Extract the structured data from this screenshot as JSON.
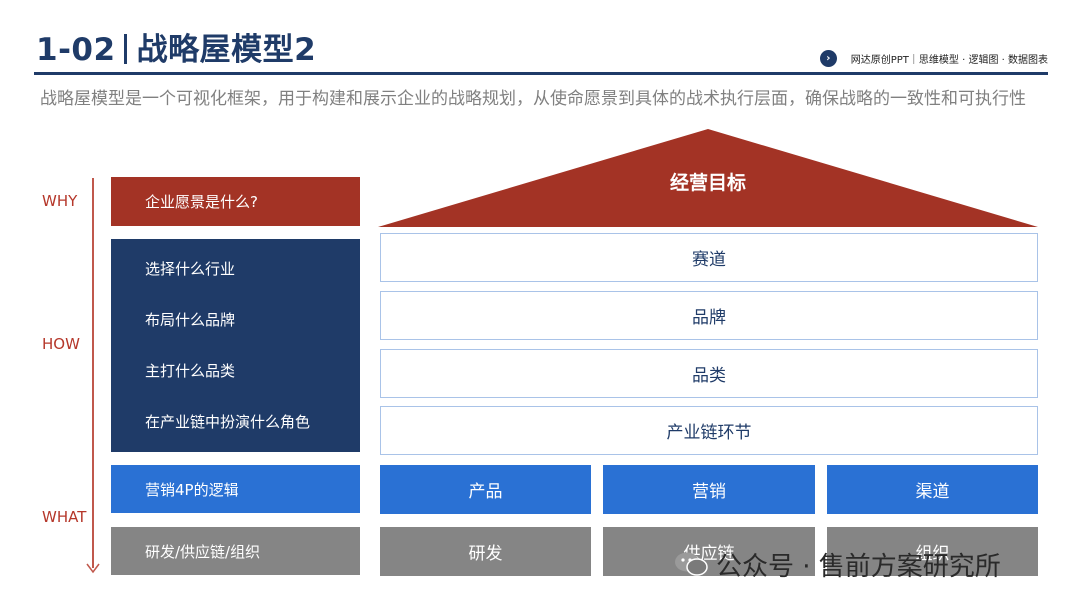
{
  "header": {
    "number": "1-02",
    "title": "战略屋模型2",
    "tagline": "网达原创PPT｜思维模型 · 逻辑图 · 数据图表"
  },
  "description": "战略屋模型是一个可视化框架，用于构建和展示企业的战略规划，从使命愿景到具体的战术执行层面，确保战略的一致性和可执行性",
  "axis": {
    "why": "WHY",
    "how": "HOW",
    "what": "WHAT"
  },
  "left": {
    "why_question": "企业愿景是什么?",
    "how_items": [
      "选择什么行业",
      "布局什么品牌",
      "主打什么品类",
      "在产业链中扮演什么角色"
    ],
    "marketing": "营销4P的逻辑",
    "supply": "研发/供应链/组织"
  },
  "house": {
    "roof": "经营目标",
    "floors": [
      "赛道",
      "品牌",
      "品类",
      "产业链环节"
    ],
    "blue_row": [
      "产品",
      "营销",
      "渠道"
    ],
    "gray_row": [
      "研发",
      "供应链",
      "组织"
    ]
  },
  "watermark": "公众号 · 售前方案研究所",
  "colors": {
    "navy": "#1f3b68",
    "red": "#a33325",
    "blue": "#2a71d4",
    "gray": "#858585"
  }
}
